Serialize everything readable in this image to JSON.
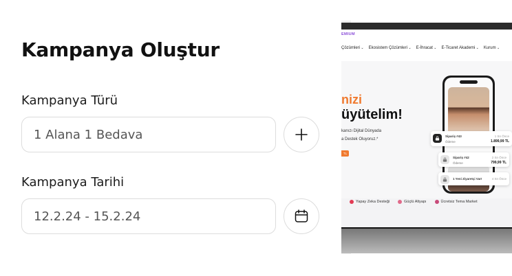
{
  "form": {
    "title": "Kampanya Oluştur",
    "campaign_type_label": "Kampanya Türü",
    "campaign_type_value": "1 Alana 1 Bedava",
    "campaign_date_label": "Kampanya Tarihi",
    "campaign_date_value": "12.2.24 - 15.2.24"
  },
  "icons": {
    "add": "plus-icon",
    "calendar": "calendar-icon"
  },
  "colors": {
    "border": "#dcdcdc",
    "accent_orange": "#f07a2f",
    "brand_purple": "#8a4dd8"
  },
  "preview": {
    "brand": "EMIUM",
    "nav": [
      "Çözümleri",
      "Ekosistem Çözümleri",
      "E-İhracat",
      "E-Ticaret Akademi",
      "Kurum"
    ],
    "headline_a": "nizi",
    "headline_b": "üyütelim!",
    "sub1": "kanızı Dijital Dünyada",
    "sub2": "a Destek Oluyoruz.*",
    "cta": "TL",
    "notifications": [
      {
        "title": "Sipariş #43",
        "subtitle": "Ödeme",
        "right1": "1 Sn Önce",
        "right2": "1.899,99 TL"
      },
      {
        "title": "Sipariş #42",
        "subtitle": "Ödeme",
        "right1": "2 Sn Önce",
        "right2": "799,99 TL"
      },
      {
        "title": "1 Yeni Ziyaretçi Var!",
        "subtitle": "",
        "right1": "4 Sn Önce",
        "right2": ""
      }
    ],
    "features": [
      "Yapay Zeka Desteği",
      "Güçlü Altyapı",
      "Ücretsiz Tema Market"
    ]
  }
}
